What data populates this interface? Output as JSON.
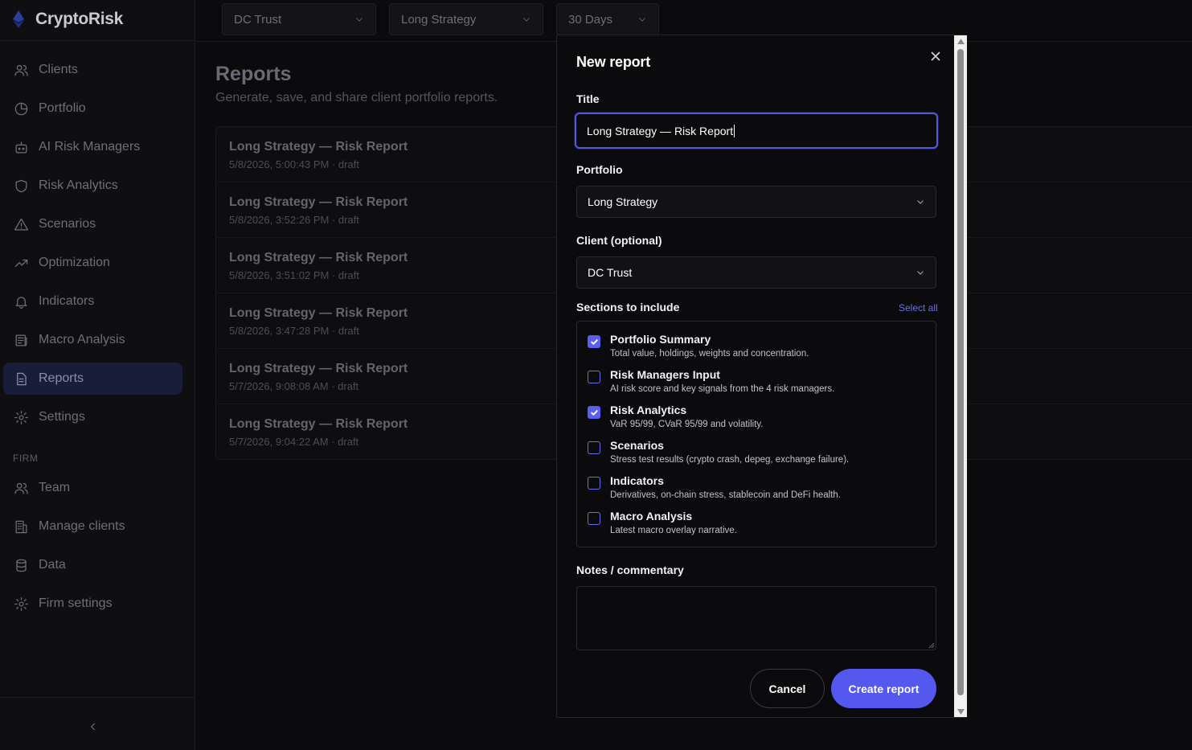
{
  "app": {
    "name": "CryptoRisk"
  },
  "sidebar": {
    "items": [
      {
        "label": "Clients",
        "icon": "users-icon"
      },
      {
        "label": "Portfolio",
        "icon": "pie-chart-icon"
      },
      {
        "label": "AI Risk Managers",
        "icon": "bot-icon"
      },
      {
        "label": "Risk Analytics",
        "icon": "shield-icon"
      },
      {
        "label": "Scenarios",
        "icon": "warning-triangle-icon"
      },
      {
        "label": "Optimization",
        "icon": "trending-up-icon"
      },
      {
        "label": "Indicators",
        "icon": "bell-icon"
      },
      {
        "label": "Macro Analysis",
        "icon": "newspaper-icon"
      },
      {
        "label": "Reports",
        "icon": "file-text-icon",
        "active": true
      },
      {
        "label": "Settings",
        "icon": "gear-icon"
      }
    ],
    "firm_label": "FIRM",
    "firm_items": [
      {
        "label": "Team",
        "icon": "users-icon"
      },
      {
        "label": "Manage clients",
        "icon": "building-icon"
      },
      {
        "label": "Data",
        "icon": "database-icon"
      },
      {
        "label": "Firm settings",
        "icon": "gear-icon"
      }
    ]
  },
  "topbar": {
    "client": "DC Trust",
    "portfolio": "Long Strategy",
    "period": "30 Days"
  },
  "page": {
    "title": "Reports",
    "subtitle": "Generate, save, and share client portfolio reports."
  },
  "reports": [
    {
      "title": "Long Strategy — Risk Report",
      "meta": "5/8/2026, 5:00:43 PM · draft"
    },
    {
      "title": "Long Strategy — Risk Report",
      "meta": "5/8/2026, 3:52:26 PM · draft"
    },
    {
      "title": "Long Strategy — Risk Report",
      "meta": "5/8/2026, 3:51:02 PM · draft"
    },
    {
      "title": "Long Strategy — Risk Report",
      "meta": "5/8/2026, 3:47:28 PM · draft"
    },
    {
      "title": "Long Strategy — Risk Report",
      "meta": "5/7/2026, 9:08:08 AM · draft"
    },
    {
      "title": "Long Strategy — Risk Report",
      "meta": "5/7/2026, 9:04:22 AM · draft"
    }
  ],
  "modal": {
    "title": "New report",
    "title_label": "Title",
    "title_value": "Long Strategy — Risk Report",
    "portfolio_label": "Portfolio",
    "portfolio_value": "Long Strategy",
    "client_label": "Client (optional)",
    "client_value": "DC Trust",
    "sections_label": "Sections to include",
    "select_all": "Select all",
    "sections": [
      {
        "title": "Portfolio Summary",
        "desc": "Total value, holdings, weights and concentration.",
        "checked": true
      },
      {
        "title": "Risk Managers Input",
        "desc": "AI risk score and key signals from the 4 risk managers.",
        "checked": false
      },
      {
        "title": "Risk Analytics",
        "desc": "VaR 95/99, CVaR 95/99 and volatility.",
        "checked": true
      },
      {
        "title": "Scenarios",
        "desc": "Stress test results (crypto crash, depeg, exchange failure).",
        "checked": false
      },
      {
        "title": "Indicators",
        "desc": "Derivatives, on-chain stress, stablecoin and DeFi health.",
        "checked": false
      },
      {
        "title": "Macro Analysis",
        "desc": "Latest macro overlay narrative.",
        "checked": false
      }
    ],
    "notes_label": "Notes / commentary",
    "notes_value": "",
    "cancel": "Cancel",
    "create": "Create report"
  },
  "colors": {
    "accent": "#5558ee",
    "background": "#0b0b0d",
    "active_nav": "#1a1d3a"
  }
}
